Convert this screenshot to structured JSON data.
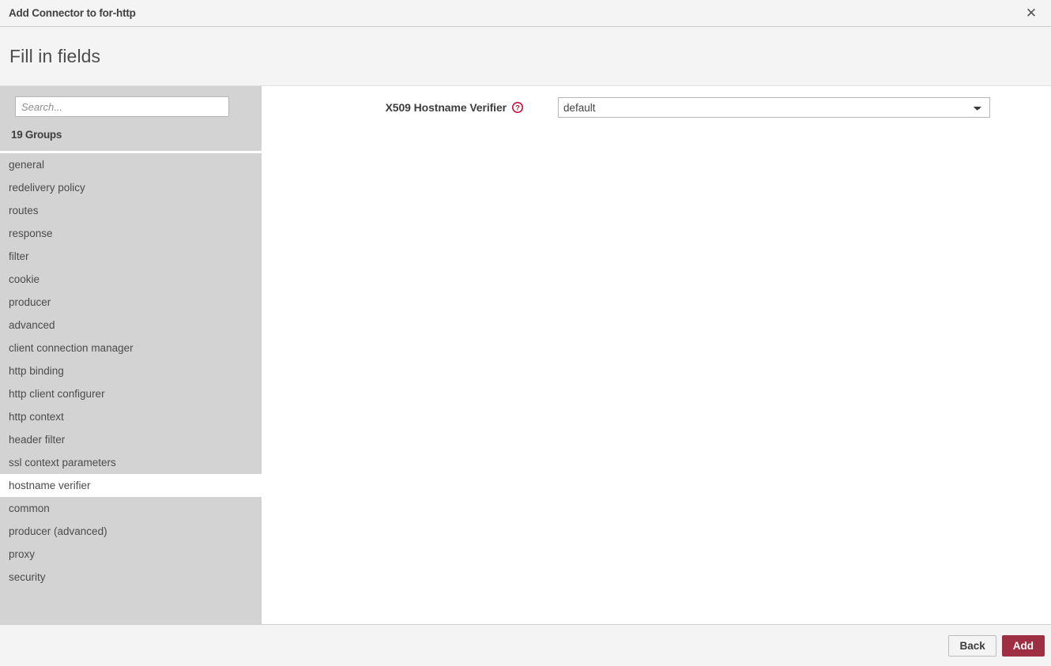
{
  "titlebar": {
    "title": "Add Connector to for-http",
    "close_icon": "close-icon",
    "close_glyph": "✕"
  },
  "heading": {
    "text": "Fill in fields"
  },
  "sidebar": {
    "search": {
      "placeholder": "Search...",
      "value": ""
    },
    "groups_count_label": "19 Groups",
    "items": [
      {
        "label": "general",
        "selected": false
      },
      {
        "label": "redelivery policy",
        "selected": false
      },
      {
        "label": "routes",
        "selected": false
      },
      {
        "label": "response",
        "selected": false
      },
      {
        "label": "filter",
        "selected": false
      },
      {
        "label": "cookie",
        "selected": false
      },
      {
        "label": "producer",
        "selected": false
      },
      {
        "label": "advanced",
        "selected": false
      },
      {
        "label": "client connection manager",
        "selected": false
      },
      {
        "label": "http binding",
        "selected": false
      },
      {
        "label": "http client configurer",
        "selected": false
      },
      {
        "label": "http context",
        "selected": false
      },
      {
        "label": "header filter",
        "selected": false
      },
      {
        "label": "ssl context parameters",
        "selected": false
      },
      {
        "label": "hostname verifier",
        "selected": true
      },
      {
        "label": "common",
        "selected": false
      },
      {
        "label": "producer (advanced)",
        "selected": false
      },
      {
        "label": "proxy",
        "selected": false
      },
      {
        "label": "security",
        "selected": false
      }
    ]
  },
  "form": {
    "fields": [
      {
        "label": "X509 Hostname Verifier",
        "help_icon": "help-circle-icon",
        "control": "select",
        "value": "default",
        "options": [
          "default"
        ]
      }
    ]
  },
  "footer": {
    "back_label": "Back",
    "add_label": "Add"
  },
  "colors": {
    "accent": "#9e2f43",
    "help_icon": "#c8102e",
    "sidebar_bg": "#d3d3d3",
    "band_bg": "#f4f4f4"
  }
}
